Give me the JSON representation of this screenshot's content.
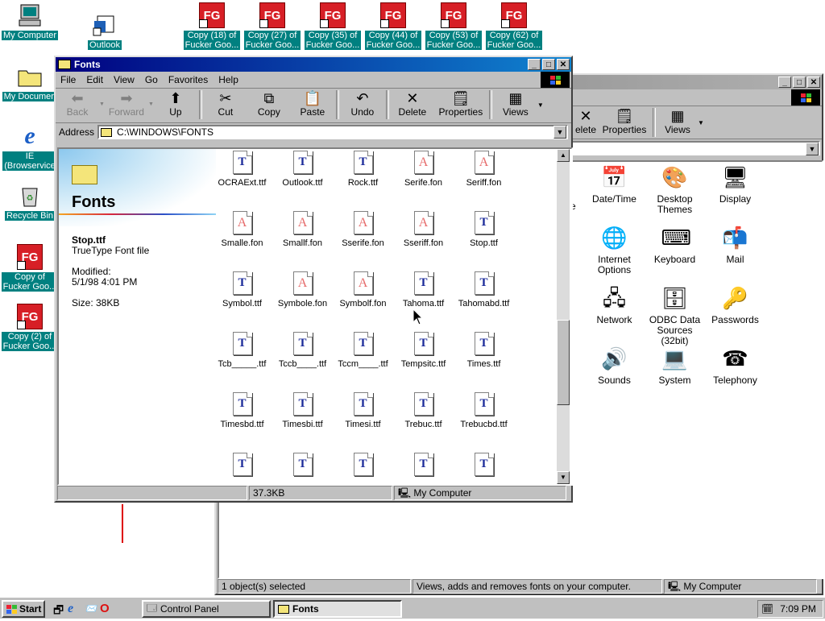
{
  "desktop": {
    "icons": [
      {
        "label": "My Computer",
        "icon": "computer-icon"
      },
      {
        "label": "Outlook",
        "icon": "outlook-icon"
      },
      {
        "label": "My Documen",
        "icon": "folder-icon"
      },
      {
        "label": "IE\n(Browservice",
        "icon": "ie-icon"
      },
      {
        "label": "Recycle Bin",
        "icon": "recycle-bin-icon"
      },
      {
        "label": "Copy of\nFucker Goo...",
        "icon": "fg-shortcut-icon"
      },
      {
        "label": "Copy (2) of\nFucker Goo...",
        "icon": "fg-shortcut-icon"
      }
    ],
    "top_shortcuts": [
      {
        "label": "Copy (18) of\nFucker Goo..."
      },
      {
        "label": "Copy (27) of\nFucker Goo..."
      },
      {
        "label": "Copy (35) of\nFucker Goo..."
      },
      {
        "label": "Copy (44) of\nFucker Goo..."
      },
      {
        "label": "Copy (53) of\nFucker Goo..."
      },
      {
        "label": "Copy (62) of\nFucker Goo..."
      }
    ],
    "fg_text": "FG"
  },
  "fonts_window": {
    "title": "Fonts",
    "menu": [
      "File",
      "Edit",
      "View",
      "Go",
      "Favorites",
      "Help"
    ],
    "toolbar": {
      "back": "Back",
      "forward": "Forward",
      "up": "Up",
      "cut": "Cut",
      "copy": "Copy",
      "paste": "Paste",
      "undo": "Undo",
      "delete": "Delete",
      "properties": "Properties",
      "views": "Views"
    },
    "address_label": "Address",
    "address_value": "C:\\WINDOWS\\FONTS",
    "info": {
      "folder_title": "Fonts",
      "file_name": "Stop.ttf",
      "file_type": "TrueType Font file",
      "modified_label": "Modified:",
      "modified_value": "5/1/98 4:01 PM",
      "size": "Size: 38KB"
    },
    "files": [
      {
        "name": "OCRAExt.ttf",
        "kind": "tt"
      },
      {
        "name": "Outlook.ttf",
        "kind": "tt"
      },
      {
        "name": "Rock.ttf",
        "kind": "tt"
      },
      {
        "name": "Serife.fon",
        "kind": "a"
      },
      {
        "name": "Seriff.fon",
        "kind": "a"
      },
      {
        "name": "Smalle.fon",
        "kind": "a"
      },
      {
        "name": "Smallf.fon",
        "kind": "a"
      },
      {
        "name": "Sserife.fon",
        "kind": "a"
      },
      {
        "name": "Sseriff.fon",
        "kind": "a"
      },
      {
        "name": "Stop.ttf",
        "kind": "tt"
      },
      {
        "name": "Symbol.ttf",
        "kind": "tt"
      },
      {
        "name": "Symbole.fon",
        "kind": "a"
      },
      {
        "name": "Symbolf.fon",
        "kind": "a"
      },
      {
        "name": "Tahoma.ttf",
        "kind": "tt"
      },
      {
        "name": "Tahomabd.ttf",
        "kind": "tt"
      },
      {
        "name": "Tcb_____.ttf",
        "kind": "tt"
      },
      {
        "name": "Tccb____.ttf",
        "kind": "tt"
      },
      {
        "name": "Tccm____.ttf",
        "kind": "tt"
      },
      {
        "name": "Tempsitc.ttf",
        "kind": "tt"
      },
      {
        "name": "Times.ttf",
        "kind": "tt"
      },
      {
        "name": "Timesbd.ttf",
        "kind": "tt"
      },
      {
        "name": "Timesbi.ttf",
        "kind": "tt"
      },
      {
        "name": "Timesi.ttf",
        "kind": "tt"
      },
      {
        "name": "Trebuc.ttf",
        "kind": "tt"
      },
      {
        "name": "Trebucbd.ttf",
        "kind": "tt"
      },
      {
        "name": "",
        "kind": "tt"
      },
      {
        "name": "",
        "kind": "tt"
      },
      {
        "name": "",
        "kind": "tt"
      },
      {
        "name": "",
        "kind": "tt"
      },
      {
        "name": "",
        "kind": "tt"
      }
    ],
    "status": {
      "size": "37.3KB",
      "location": "My Computer"
    }
  },
  "control_panel": {
    "toolbar": {
      "delete": "elete",
      "properties": "Properties",
      "views": "Views"
    },
    "items": [
      {
        "label": "Date/Time",
        "icon": "calendar-clock-icon",
        "glyph": "📅"
      },
      {
        "label": "Desktop\nThemes",
        "icon": "desktop-themes-icon",
        "glyph": "🎨"
      },
      {
        "label": "Display",
        "icon": "display-icon",
        "glyph": "🖥"
      },
      {
        "label": "Internet\nOptions",
        "icon": "internet-options-icon",
        "glyph": "🌐"
      },
      {
        "label": "Keyboard",
        "icon": "keyboard-icon",
        "glyph": "⌨"
      },
      {
        "label": "Mail",
        "icon": "mail-icon",
        "glyph": "📬"
      },
      {
        "label": "Network",
        "icon": "network-icon",
        "glyph": "🖧"
      },
      {
        "label": "ODBC Data\nSources (32bit)",
        "icon": "odbc-icon",
        "glyph": "🗄"
      },
      {
        "label": "Passwords",
        "icon": "keys-icon",
        "glyph": "🔑"
      },
      {
        "label": "Sounds",
        "icon": "speaker-icon",
        "glyph": "🔊"
      },
      {
        "label": "System",
        "icon": "system-icon",
        "glyph": "💻"
      },
      {
        "label": "Telephony",
        "icon": "telephone-icon",
        "glyph": "☎"
      }
    ],
    "edge_letter": "e",
    "status": {
      "selected": "1 object(s) selected",
      "desc": "Views, adds and removes fonts on your computer.",
      "location": "My Computer"
    }
  },
  "taskbar": {
    "start": "Start",
    "tasks": [
      {
        "label": "Control Panel"
      },
      {
        "label": "Fonts"
      }
    ],
    "clock": "7:09 PM"
  }
}
